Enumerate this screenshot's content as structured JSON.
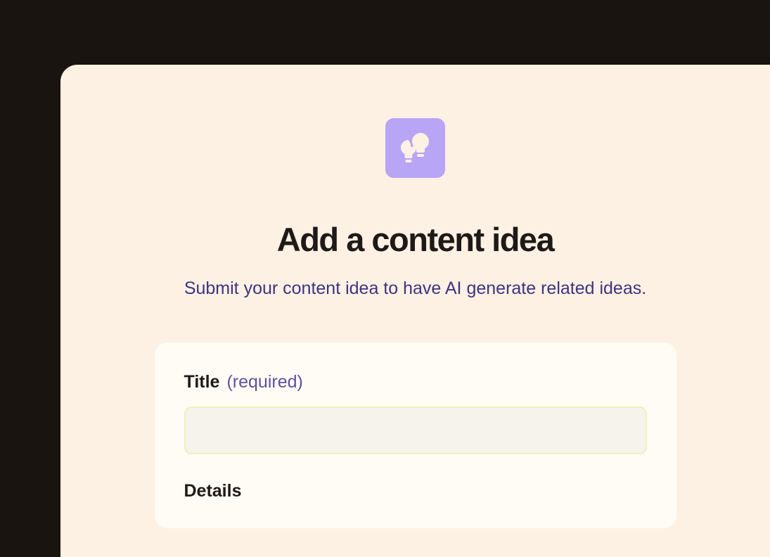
{
  "modal": {
    "heading": "Add a content idea",
    "subheading": "Submit your content idea to have AI generate related ideas."
  },
  "form": {
    "title": {
      "label": "Title",
      "required_text": "(required)",
      "value": ""
    },
    "details": {
      "label": "Details"
    }
  },
  "icon": {
    "name": "lightbulbs-icon"
  }
}
